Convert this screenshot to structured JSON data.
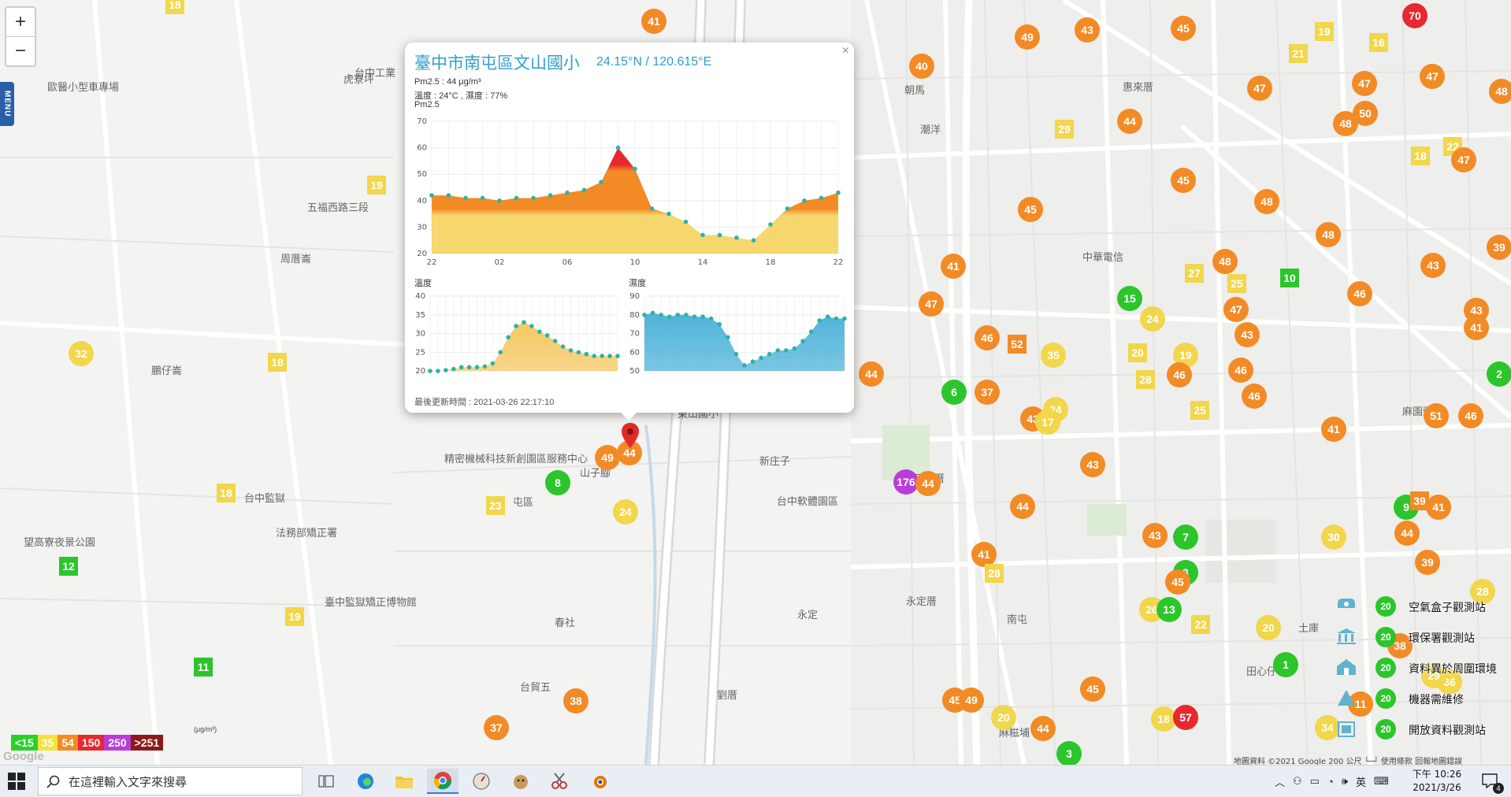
{
  "map": {
    "zoom_in": "+",
    "zoom_out": "−",
    "menu_label": "MENU",
    "places": [
      {
        "name": "虎寮坪",
        "x": 436,
        "y": 90
      },
      {
        "name": "台中工業",
        "x": 450,
        "y": 82
      },
      {
        "name": "歐醫小型車專場",
        "x": 60,
        "y": 100
      },
      {
        "name": "周厝崙",
        "x": 356,
        "y": 318
      },
      {
        "name": "鵬仔崙",
        "x": 192,
        "y": 460
      },
      {
        "name": "五福西路三段",
        "x": 390,
        "y": 253
      },
      {
        "name": "潮洋",
        "x": 1168,
        "y": 154
      },
      {
        "name": "惠來厝",
        "x": 1425,
        "y": 100
      },
      {
        "name": "麻園頭",
        "x": 1780,
        "y": 512
      },
      {
        "name": "新庄子",
        "x": 964,
        "y": 575
      },
      {
        "name": "山子腳",
        "x": 736,
        "y": 590
      },
      {
        "name": "屯區",
        "x": 651,
        "y": 627
      },
      {
        "name": "永定厝",
        "x": 1150,
        "y": 753
      },
      {
        "name": "永定",
        "x": 1012,
        "y": 770
      },
      {
        "name": "春社",
        "x": 704,
        "y": 780
      },
      {
        "name": "台貿五",
        "x": 660,
        "y": 862
      },
      {
        "name": "劉厝",
        "x": 910,
        "y": 872
      },
      {
        "name": "南屯",
        "x": 1278,
        "y": 776
      },
      {
        "name": "田心仔",
        "x": 1582,
        "y": 842
      },
      {
        "name": "三塊厝",
        "x": 1160,
        "y": 597
      },
      {
        "name": "土庫",
        "x": 1648,
        "y": 787
      },
      {
        "name": "麻糍埔",
        "x": 1268,
        "y": 920
      },
      {
        "name": "台中監獄",
        "x": 310,
        "y": 622
      },
      {
        "name": "東山國小",
        "x": 860,
        "y": 515
      },
      {
        "name": "臺中監獄矯正博物館",
        "x": 412,
        "y": 754
      },
      {
        "name": "法務部矯正署",
        "x": 350,
        "y": 666
      },
      {
        "name": "望高寮夜景公園",
        "x": 30,
        "y": 678
      },
      {
        "name": "台中軟體園區",
        "x": 986,
        "y": 626
      },
      {
        "name": "精密機械科技新創園區服務中心",
        "x": 564,
        "y": 572
      },
      {
        "name": "朝馬",
        "x": 1148,
        "y": 104
      },
      {
        "name": "中華電信",
        "x": 1374,
        "y": 316
      }
    ],
    "markers": [
      {
        "v": 41,
        "x": 830,
        "y": 27,
        "c": "#f28b26",
        "s": "circle"
      },
      {
        "v": 49,
        "x": 1304,
        "y": 47,
        "c": "#f28b26",
        "s": "circle"
      },
      {
        "v": 43,
        "x": 1380,
        "y": 38,
        "c": "#f28b26",
        "s": "circle"
      },
      {
        "v": 45,
        "x": 1502,
        "y": 36,
        "c": "#f28b26",
        "s": "circle"
      },
      {
        "v": 70,
        "x": 1796,
        "y": 20,
        "c": "#e6282f",
        "s": "circle"
      },
      {
        "v": 40,
        "x": 1170,
        "y": 84,
        "c": "#f28b26",
        "s": "circle"
      },
      {
        "v": 21,
        "x": 1648,
        "y": 68,
        "c": "#f2d64b",
        "s": "square"
      },
      {
        "v": 19,
        "x": 1681,
        "y": 40,
        "c": "#f2d64b",
        "s": "square"
      },
      {
        "v": 16,
        "x": 1750,
        "y": 54,
        "c": "#f2d64b",
        "s": "square"
      },
      {
        "v": 47,
        "x": 1599,
        "y": 112,
        "c": "#f28b26",
        "s": "circle"
      },
      {
        "v": 47,
        "x": 1732,
        "y": 106,
        "c": "#f28b26",
        "s": "circle"
      },
      {
        "v": 47,
        "x": 1818,
        "y": 97,
        "c": "#f28b26",
        "s": "circle"
      },
      {
        "v": 48,
        "x": 1906,
        "y": 116,
        "c": "#f28b26",
        "s": "circle"
      },
      {
        "v": 44,
        "x": 1434,
        "y": 154,
        "c": "#f28b26",
        "s": "circle"
      },
      {
        "v": 29,
        "x": 1351,
        "y": 164,
        "c": "#f2d64b",
        "s": "square"
      },
      {
        "v": 48,
        "x": 1708,
        "y": 157,
        "c": "#f28b26",
        "s": "circle"
      },
      {
        "v": 50,
        "x": 1733,
        "y": 144,
        "c": "#f28b26",
        "s": "circle"
      },
      {
        "v": 18,
        "x": 1803,
        "y": 198,
        "c": "#f2d64b",
        "s": "square"
      },
      {
        "v": 22,
        "x": 1844,
        "y": 186,
        "c": "#f2d64b",
        "s": "square"
      },
      {
        "v": 47,
        "x": 1858,
        "y": 203,
        "c": "#f28b26",
        "s": "circle"
      },
      {
        "v": 45,
        "x": 1502,
        "y": 229,
        "c": "#f28b26",
        "s": "circle"
      },
      {
        "v": 48,
        "x": 1608,
        "y": 256,
        "c": "#f28b26",
        "s": "circle"
      },
      {
        "v": 45,
        "x": 1308,
        "y": 266,
        "c": "#f28b26",
        "s": "circle"
      },
      {
        "v": 48,
        "x": 1686,
        "y": 298,
        "c": "#f28b26",
        "s": "circle"
      },
      {
        "v": 41,
        "x": 1210,
        "y": 338,
        "c": "#f28b26",
        "s": "circle"
      },
      {
        "v": 48,
        "x": 1555,
        "y": 332,
        "c": "#f28b26",
        "s": "circle"
      },
      {
        "v": 27,
        "x": 1516,
        "y": 347,
        "c": "#f2d64b",
        "s": "square"
      },
      {
        "v": 25,
        "x": 1570,
        "y": 360,
        "c": "#f2d64b",
        "s": "square"
      },
      {
        "v": 10,
        "x": 1637,
        "y": 353,
        "c": "#2cc52c",
        "s": "square"
      },
      {
        "v": 43,
        "x": 1819,
        "y": 337,
        "c": "#f28b26",
        "s": "circle"
      },
      {
        "v": 39,
        "x": 1903,
        "y": 314,
        "c": "#f28b26",
        "s": "circle"
      },
      {
        "v": 46,
        "x": 1726,
        "y": 373,
        "c": "#f28b26",
        "s": "circle"
      },
      {
        "v": 15,
        "x": 1434,
        "y": 379,
        "c": "#2cc52c",
        "s": "circle"
      },
      {
        "v": 24,
        "x": 1463,
        "y": 405,
        "c": "#f2d64b",
        "s": "circle"
      },
      {
        "v": 47,
        "x": 1182,
        "y": 386,
        "c": "#f28b26",
        "s": "circle"
      },
      {
        "v": 47,
        "x": 1569,
        "y": 393,
        "c": "#f28b26",
        "s": "circle"
      },
      {
        "v": 43,
        "x": 1874,
        "y": 394,
        "c": "#f28b26",
        "s": "circle"
      },
      {
        "v": 41,
        "x": 1874,
        "y": 416,
        "c": "#f28b26",
        "s": "circle"
      },
      {
        "v": 43,
        "x": 1583,
        "y": 425,
        "c": "#f28b26",
        "s": "circle"
      },
      {
        "v": 46,
        "x": 1253,
        "y": 429,
        "c": "#f28b26",
        "s": "circle"
      },
      {
        "v": 52,
        "x": 1291,
        "y": 437,
        "c": "#f28b26",
        "s": "square"
      },
      {
        "v": 35,
        "x": 1337,
        "y": 451,
        "c": "#f2d64b",
        "s": "circle"
      },
      {
        "v": 20,
        "x": 1444,
        "y": 448,
        "c": "#f2d64b",
        "s": "square"
      },
      {
        "v": 19,
        "x": 1505,
        "y": 451,
        "c": "#f2d64b",
        "s": "circle"
      },
      {
        "v": 46,
        "x": 1575,
        "y": 470,
        "c": "#f28b26",
        "s": "circle"
      },
      {
        "v": 46,
        "x": 1497,
        "y": 476,
        "c": "#f28b26",
        "s": "circle"
      },
      {
        "v": 28,
        "x": 1454,
        "y": 482,
        "c": "#f2d64b",
        "s": "square"
      },
      {
        "v": 2,
        "x": 1903,
        "y": 475,
        "c": "#2cc52c",
        "s": "circle"
      },
      {
        "v": 44,
        "x": 1106,
        "y": 475,
        "c": "#f28b26",
        "s": "circle"
      },
      {
        "v": 6,
        "x": 1211,
        "y": 498,
        "c": "#2cc52c",
        "s": "circle"
      },
      {
        "v": 37,
        "x": 1253,
        "y": 498,
        "c": "#f28b26",
        "s": "circle"
      },
      {
        "v": 46,
        "x": 1592,
        "y": 503,
        "c": "#f28b26",
        "s": "circle"
      },
      {
        "v": 25,
        "x": 1523,
        "y": 521,
        "c": "#f2d64b",
        "s": "square"
      },
      {
        "v": 43,
        "x": 1311,
        "y": 532,
        "c": "#f28b26",
        "s": "circle"
      },
      {
        "v": 24,
        "x": 1340,
        "y": 520,
        "c": "#f2d64b",
        "s": "circle"
      },
      {
        "v": 17,
        "x": 1330,
        "y": 536,
        "c": "#f2d64b",
        "s": "circle"
      },
      {
        "v": 51,
        "x": 1823,
        "y": 528,
        "c": "#f28b26",
        "s": "circle"
      },
      {
        "v": 46,
        "x": 1867,
        "y": 528,
        "c": "#f28b26",
        "s": "circle"
      },
      {
        "v": 41,
        "x": 1693,
        "y": 545,
        "c": "#f28b26",
        "s": "circle"
      },
      {
        "v": 43,
        "x": 1387,
        "y": 590,
        "c": "#f28b26",
        "s": "circle"
      },
      {
        "v": 176,
        "x": 1150,
        "y": 612,
        "c": "#b73ed9",
        "s": "circle"
      },
      {
        "v": 44,
        "x": 1178,
        "y": 614,
        "c": "#f28b26",
        "s": "circle"
      },
      {
        "v": 44,
        "x": 1298,
        "y": 643,
        "c": "#f28b26",
        "s": "circle"
      },
      {
        "v": 9,
        "x": 1785,
        "y": 644,
        "c": "#2cc52c",
        "s": "circle"
      },
      {
        "v": 39,
        "x": 1802,
        "y": 636,
        "c": "#f28b26",
        "s": "square"
      },
      {
        "v": 41,
        "x": 1826,
        "y": 644,
        "c": "#f28b26",
        "s": "circle"
      },
      {
        "v": 43,
        "x": 1466,
        "y": 680,
        "c": "#f28b26",
        "s": "circle"
      },
      {
        "v": 7,
        "x": 1505,
        "y": 682,
        "c": "#2cc52c",
        "s": "circle"
      },
      {
        "v": 30,
        "x": 1693,
        "y": 682,
        "c": "#f2d64b",
        "s": "circle"
      },
      {
        "v": 44,
        "x": 1786,
        "y": 677,
        "c": "#f28b26",
        "s": "circle"
      },
      {
        "v": 41,
        "x": 1249,
        "y": 704,
        "c": "#f28b26",
        "s": "circle"
      },
      {
        "v": 39,
        "x": 1812,
        "y": 714,
        "c": "#f28b26",
        "s": "circle"
      },
      {
        "v": 28,
        "x": 1262,
        "y": 728,
        "c": "#f2d64b",
        "s": "square"
      },
      {
        "v": 3,
        "x": 1505,
        "y": 727,
        "c": "#2cc52c",
        "s": "circle"
      },
      {
        "v": 45,
        "x": 1495,
        "y": 739,
        "c": "#f28b26",
        "s": "circle"
      },
      {
        "v": 28,
        "x": 1882,
        "y": 751,
        "c": "#f2d64b",
        "s": "circle"
      },
      {
        "v": 26,
        "x": 1462,
        "y": 774,
        "c": "#f2d64b",
        "s": "circle"
      },
      {
        "v": 13,
        "x": 1484,
        "y": 774,
        "c": "#2cc52c",
        "s": "circle"
      },
      {
        "v": 22,
        "x": 1524,
        "y": 793,
        "c": "#f2d64b",
        "s": "square"
      },
      {
        "v": 20,
        "x": 1610,
        "y": 797,
        "c": "#f2d64b",
        "s": "circle"
      },
      {
        "v": 38,
        "x": 1777,
        "y": 820,
        "c": "#f28b26",
        "s": "circle"
      },
      {
        "v": 1,
        "x": 1632,
        "y": 844,
        "c": "#2cc52c",
        "s": "circle"
      },
      {
        "v": 11,
        "x": 1727,
        "y": 894,
        "c": "#f28b26",
        "s": "circle"
      },
      {
        "v": 45,
        "x": 1387,
        "y": 875,
        "c": "#f28b26",
        "s": "circle"
      },
      {
        "v": 45,
        "x": 1212,
        "y": 889,
        "c": "#f28b26",
        "s": "circle"
      },
      {
        "v": 49,
        "x": 1233,
        "y": 889,
        "c": "#f28b26",
        "s": "circle"
      },
      {
        "v": 20,
        "x": 1274,
        "y": 911,
        "c": "#f2d64b",
        "s": "circle"
      },
      {
        "v": 44,
        "x": 1324,
        "y": 925,
        "c": "#f28b26",
        "s": "circle"
      },
      {
        "v": 18,
        "x": 1477,
        "y": 913,
        "c": "#f2d64b",
        "s": "circle"
      },
      {
        "v": 57,
        "x": 1505,
        "y": 911,
        "c": "#e6282f",
        "s": "circle"
      },
      {
        "v": 34,
        "x": 1685,
        "y": 924,
        "c": "#f2d64b",
        "s": "circle"
      },
      {
        "v": 3,
        "x": 1357,
        "y": 957,
        "c": "#2cc52c",
        "s": "circle"
      },
      {
        "v": 36,
        "x": 1840,
        "y": 866,
        "c": "#f2d64b",
        "s": "circle"
      },
      {
        "v": 29,
        "x": 1820,
        "y": 858,
        "c": "#f2d64b",
        "s": "circle"
      },
      {
        "v": 18,
        "x": 222,
        "y": 6,
        "c": "#f2d64b",
        "s": "square"
      },
      {
        "v": 19,
        "x": 478,
        "y": 235,
        "c": "#f2d64b",
        "s": "square"
      },
      {
        "v": 32,
        "x": 103,
        "y": 449,
        "c": "#f2d64b",
        "s": "circle"
      },
      {
        "v": 18,
        "x": 352,
        "y": 460,
        "c": "#f2d64b",
        "s": "square"
      },
      {
        "v": 18,
        "x": 287,
        "y": 626,
        "c": "#f2d64b",
        "s": "square"
      },
      {
        "v": 12,
        "x": 87,
        "y": 719,
        "c": "#2cc52c",
        "s": "square"
      },
      {
        "v": 19,
        "x": 374,
        "y": 783,
        "c": "#f2d64b",
        "s": "square"
      },
      {
        "v": 11,
        "x": 258,
        "y": 847,
        "c": "#2cc52c",
        "s": "square"
      },
      {
        "v": 8,
        "x": 708,
        "y": 613,
        "c": "#2cc52c",
        "s": "circle"
      },
      {
        "v": 49,
        "x": 771,
        "y": 581,
        "c": "#f28b26",
        "s": "circle"
      },
      {
        "v": 44,
        "x": 799,
        "y": 575,
        "c": "#f28b26",
        "s": "circle"
      },
      {
        "v": 23,
        "x": 629,
        "y": 642,
        "c": "#f2d64b",
        "s": "square"
      },
      {
        "v": 24,
        "x": 794,
        "y": 650,
        "c": "#f2d64b",
        "s": "circle"
      },
      {
        "v": 38,
        "x": 731,
        "y": 890,
        "c": "#f28b26",
        "s": "circle"
      },
      {
        "v": 37,
        "x": 630,
        "y": 924,
        "c": "#f28b26",
        "s": "circle"
      }
    ]
  },
  "popup": {
    "close_label": "×",
    "title": "臺中市南屯區文山國小",
    "coords": "24.15°N / 120.615°E",
    "pm25_line": "Pm2.5 : 44 μg/m³",
    "weather_line": "溫度 : 24°C , 濕度 : 77%",
    "chart_label": "Pm2.5",
    "temp_label": "溫度",
    "humid_label": "濕度",
    "updated": "最後更新時間 : 2021-03-26 22:17:10"
  },
  "chart_data": [
    {
      "type": "area",
      "title": "Pm2.5",
      "x": [
        "22",
        "23",
        "00",
        "01",
        "02",
        "03",
        "04",
        "05",
        "06",
        "07",
        "08",
        "09",
        "10",
        "11",
        "12",
        "13",
        "14",
        "15",
        "16",
        "17",
        "18",
        "19",
        "20",
        "21",
        "22"
      ],
      "xticks": [
        "22",
        "02",
        "06",
        "10",
        "14",
        "18",
        "22"
      ],
      "values": [
        42,
        42,
        41,
        41,
        40,
        41,
        41,
        42,
        43,
        44,
        47,
        60,
        52,
        37,
        35,
        32,
        27,
        27,
        26,
        25,
        31,
        37,
        40,
        41,
        43
      ],
      "ylim": [
        20,
        70
      ],
      "yticks": [
        20,
        30,
        40,
        50,
        60,
        70
      ],
      "colors": [
        "#f5d76e",
        "#f28b26",
        "#e6282f"
      ]
    },
    {
      "type": "area",
      "title": "溫度",
      "values": [
        20,
        20,
        20.2,
        20.5,
        21,
        21,
        21,
        21.2,
        22,
        25,
        29,
        32,
        33,
        32,
        30.5,
        29.5,
        28,
        26.5,
        25.5,
        25,
        24.5,
        24,
        24,
        24,
        24
      ],
      "ylim": [
        20,
        40
      ],
      "yticks": [
        20,
        25,
        30,
        35,
        40
      ],
      "colors": [
        "#f5c864"
      ]
    },
    {
      "type": "area",
      "title": "濕度",
      "values": [
        80,
        81,
        80,
        79,
        80,
        80,
        79,
        79,
        78,
        75,
        68,
        59,
        53,
        55,
        57,
        59,
        61,
        61,
        62,
        66,
        71,
        77,
        79,
        78,
        78
      ],
      "ylim": [
        50,
        90
      ],
      "yticks": [
        50,
        60,
        70,
        80,
        90
      ],
      "colors": [
        "#4fb3d9"
      ]
    }
  ],
  "aqi_scale": [
    {
      "label": "<15",
      "color": "#2ad12a"
    },
    {
      "label": "35",
      "color": "#f2e33d"
    },
    {
      "label": "54",
      "color": "#f28b26"
    },
    {
      "label": "150",
      "color": "#e6282f"
    },
    {
      "label": "250",
      "color": "#b73ed9"
    },
    {
      "label": ">251",
      "color": "#8c1a1a"
    }
  ],
  "aqi_unit": "(μg/m³)",
  "legend": [
    {
      "icon": "airbox-icon",
      "num": "20",
      "label": "空氣盒子觀測站"
    },
    {
      "icon": "epa-station-icon",
      "num": "20",
      "label": "環保署觀測站"
    },
    {
      "icon": "abnormal-data-icon",
      "num": "20",
      "label": "資料異於周圍環境"
    },
    {
      "icon": "repair-needed-icon",
      "num": "20",
      "label": "機器需維修"
    },
    {
      "icon": "open-data-icon",
      "num": "20",
      "label": "開放資料觀測站"
    }
  ],
  "attribution": "地圖資料 ©2021 Google   200 公尺 └─┘   使用條款   回報地圖錯誤",
  "google_logo": "Google",
  "taskbar": {
    "search_placeholder": "在這裡輸入文字來搜尋",
    "ime": "英",
    "time": "下午 10:26",
    "date": "2021/3/26",
    "notif_count": "4"
  }
}
